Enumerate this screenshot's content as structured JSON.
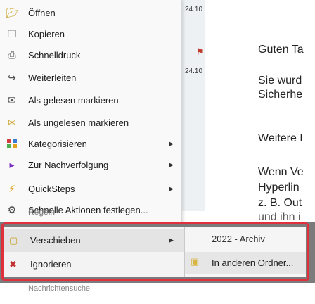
{
  "background": {
    "strip": {
      "date_1": "24.10",
      "date_2": "24.10"
    },
    "email_lines": [
      "Guten Ta",
      "Sie wurd",
      "Sicherhe",
      "Weitere I",
      "Wenn Ve",
      "Hyperlin",
      "z. B. Out",
      "und ihn i"
    ]
  },
  "menu": {
    "items": [
      {
        "label": "Öffnen",
        "icon": "open-icon"
      },
      {
        "label": "Kopieren",
        "icon": "copy-icon"
      },
      {
        "label": "Schnelldruck",
        "icon": "quick-print-icon"
      },
      {
        "label": "Weiterleiten",
        "icon": "forward-icon"
      },
      {
        "label": "Als gelesen markieren",
        "icon": "mark-read-icon"
      },
      {
        "label": "Als ungelesen markieren",
        "icon": "mark-unread-icon"
      },
      {
        "label": "Kategorisieren",
        "icon": "categorize-icon",
        "has_submenu": true
      },
      {
        "label": "Zur Nachverfolgung",
        "icon": "follow-up-flag-icon",
        "has_submenu": true
      },
      {
        "label": "QuickSteps",
        "icon": "quicksteps-icon",
        "has_submenu": true
      },
      {
        "label": "Schnelle Aktionen festlegen...",
        "icon": "quick-actions-icon"
      }
    ],
    "partially_visible_label": "Regeln",
    "highlighted": {
      "move_label": "Verschieben",
      "ignore_label": "Ignorieren"
    },
    "bottom_partial": "Nachrichtensuche"
  },
  "submenu": {
    "items": [
      {
        "label": "2022 - Archiv"
      },
      {
        "label": "In anderen Ordner..."
      }
    ]
  },
  "colors": {
    "highlight_outline": "#e0303e",
    "menu_bg": "#f9f9f9",
    "band_bg": "#7b7b7b"
  }
}
